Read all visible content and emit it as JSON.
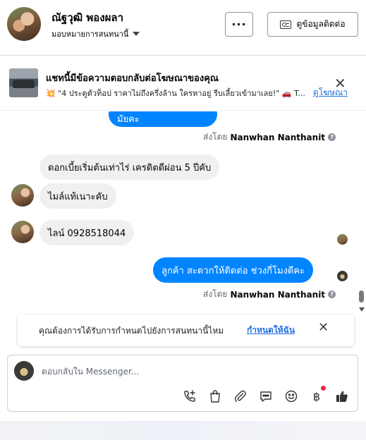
{
  "header": {
    "contact_name": "ณัฐวุฒิ พองผลา",
    "assign_label": "มอบหมายการสนทนานี้",
    "more_label": "···",
    "contact_info_label": "ดูข้อมูลติดต่อ"
  },
  "ad_banner": {
    "title": "แชทนี้มีข้อความตอบกลับต่อโฆษณาของคุณ",
    "subtitle": "\"4 ประตูตัวท็อป ราคาไม่ถึงครึ่งล้าน ใครหาอยู่ รีบเลี้ยวเข้ามาเลย!\" 🚗 T...",
    "view_ad_label": "ดูโฆษณา"
  },
  "messages": [
    {
      "direction": "out",
      "text": "มัยคะ"
    },
    {
      "direction": "meta",
      "sent_by_prefix": "ส่งโดย",
      "sent_by_name": "Nanwhan Nanthanit"
    },
    {
      "direction": "in",
      "text": "ดอกเบี้ยเริ่มต้นเท่าไร่ เครดิตดีผ่อน 5 ปีคับ"
    },
    {
      "direction": "in",
      "text": "ไมล์แท้เนาะคับ"
    },
    {
      "direction": "in",
      "text": "ไลน์ 0928518044"
    },
    {
      "direction": "out",
      "text": "ลูกค้า สะดวกให้ติดต่อ ช่วงกี่โมงดีคะ"
    },
    {
      "direction": "meta",
      "sent_by_prefix": "ส่งโดย",
      "sent_by_name": "Nanwhan Nanthanit"
    }
  ],
  "assign_prompt": {
    "text": "คุณต้องการได้รับการกำหนดไปยังการสนทนานี้ไหม",
    "link": "กำหนดให้ฉัน"
  },
  "composer": {
    "placeholder": "ตอบกลับใน Messenger...",
    "tools": [
      "phone-add-icon",
      "shopping-bag-icon",
      "paperclip-icon",
      "saved-reply-icon",
      "emoji-icon",
      "baht-icon",
      "like-icon"
    ]
  },
  "colors": {
    "accent": "#0084ff",
    "link": "#216fdb",
    "incoming_bubble": "#f0f0f0",
    "notification": "#f02849"
  }
}
